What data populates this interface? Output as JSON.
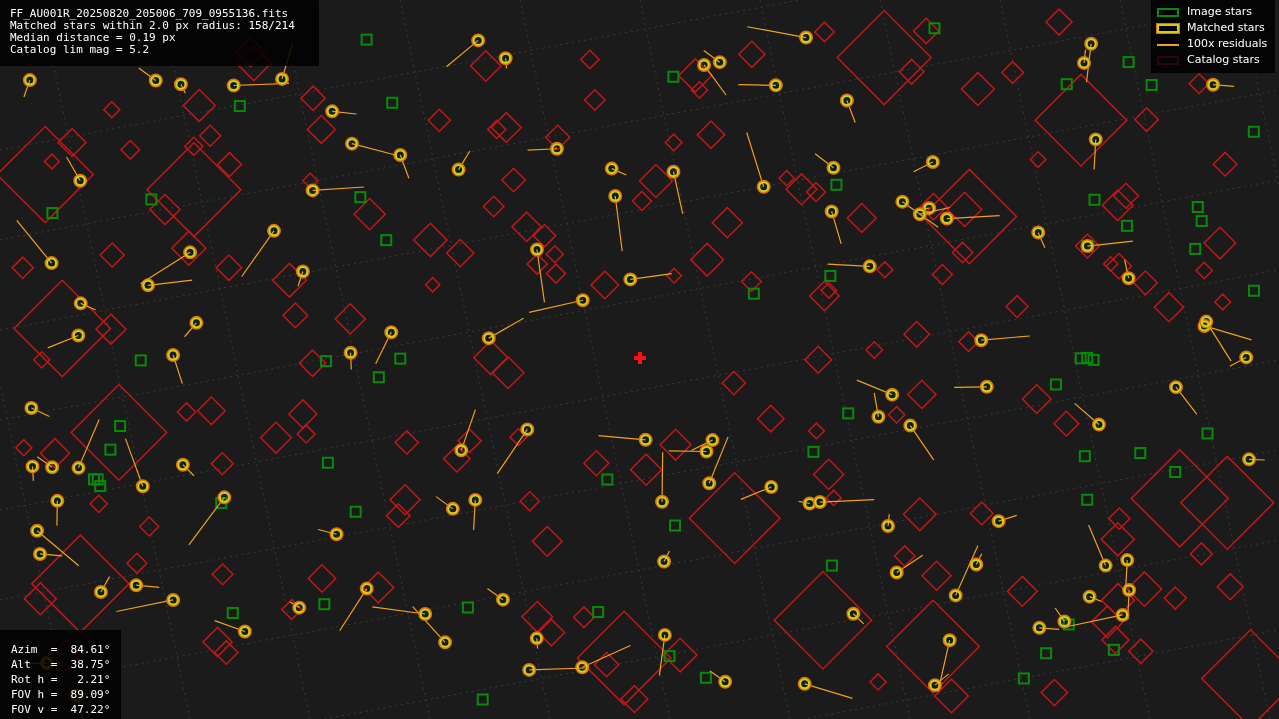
{
  "info_lines": [
    "FF_AU001R_20250820_205006_709_0955136.fits",
    "Matched stars within 2.0 px radius: 158/214",
    "Median distance = 0.19 px",
    "Catalog lim mag = 5.2"
  ],
  "legend": [
    {
      "kind": "image",
      "label": "Image stars"
    },
    {
      "kind": "matched",
      "label": "Matched stars"
    },
    {
      "kind": "residual",
      "label": "100x residuals"
    },
    {
      "kind": "catalog",
      "label": "Catalog stars"
    }
  ],
  "pointing": [
    "Azim  =  84.61°",
    "Alt   =  38.75°",
    "Rot h =   2.21°",
    "FOV h =  89.09°",
    "FOV v =  47.22°"
  ]
}
